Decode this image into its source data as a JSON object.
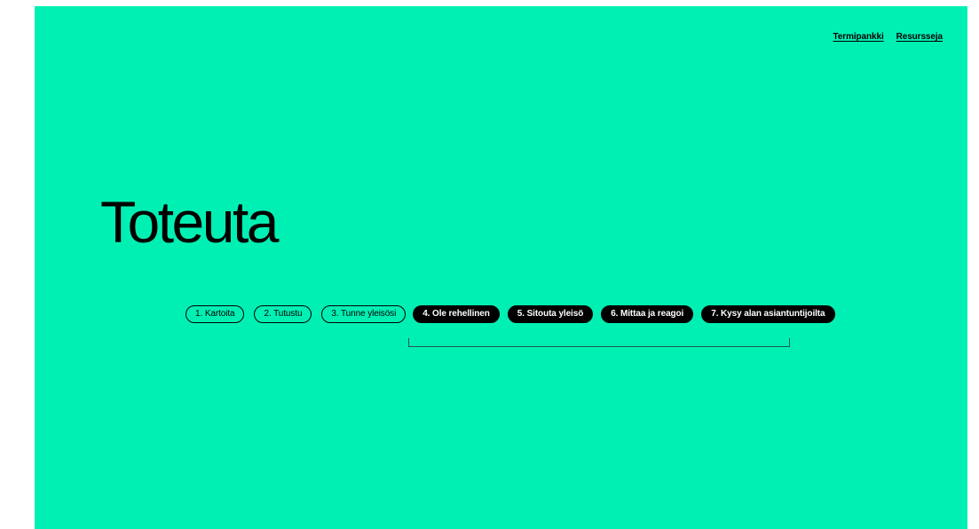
{
  "nav": {
    "links": [
      "Termipankki",
      "Resursseja"
    ]
  },
  "hero": {
    "title": "Toteuta"
  },
  "steps": [
    {
      "label": "1. Kartoita",
      "active": false
    },
    {
      "label": "2. Tutustu",
      "active": false
    },
    {
      "label": "3. Tunne yleisösi",
      "active": false
    },
    {
      "label": "4. Ole rehellinen",
      "active": true
    },
    {
      "label": "5. Sitouta yleisö",
      "active": true
    },
    {
      "label": "6. Mittaa ja reagoi",
      "active": true
    },
    {
      "label": "7. Kysy alan asiantuntijoilta",
      "active": true
    }
  ],
  "colors": {
    "background": "#00f0b4",
    "active_pill": "#000000",
    "active_pill_text": "#ffffff",
    "outline_pill_text": "#000000"
  }
}
